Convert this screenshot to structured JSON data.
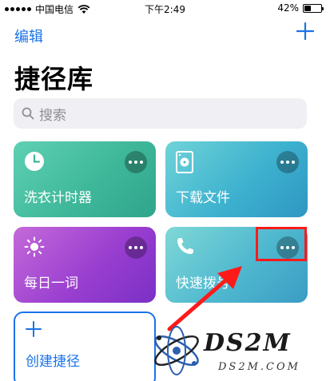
{
  "status_bar": {
    "carrier": "中国电信",
    "time": "下午2:49",
    "battery_percent": "42%",
    "battery_level": 0.42
  },
  "nav": {
    "edit_label": "编辑",
    "add_icon": "plus-icon"
  },
  "page": {
    "title": "捷径库"
  },
  "search": {
    "placeholder": "搜索"
  },
  "shortcuts": [
    {
      "label": "洗衣计时器",
      "icon": "clock-icon",
      "color": "#3fb89a"
    },
    {
      "label": "下载文件",
      "icon": "document-icon",
      "color": "#3eb2cf"
    },
    {
      "label": "每日一词",
      "icon": "sun-icon",
      "color": "#9a3fd0"
    },
    {
      "label": "快速拨号",
      "icon": "phone-icon",
      "color": "#4fb8cf"
    }
  ],
  "create": {
    "label": "创建捷径"
  },
  "watermark": {
    "main": "DS2M",
    "sub": "DS2M.COM"
  },
  "colors": {
    "accent": "#1a73e8",
    "highlight": "#ff1a1a"
  }
}
